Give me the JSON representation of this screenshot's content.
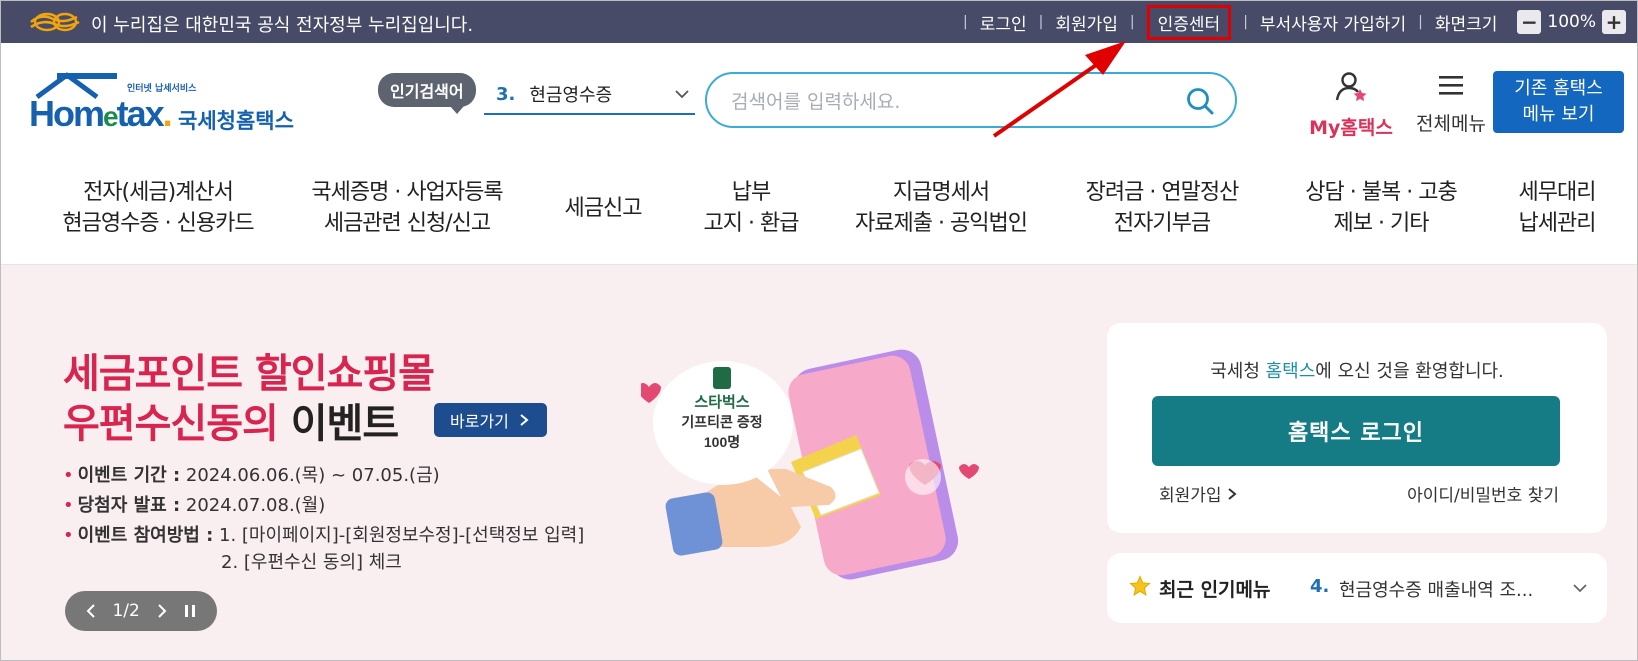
{
  "govbar": {
    "text": "이 누리집은 대한민국 공식 전자정부 누리집입니다.",
    "links": [
      "로그인",
      "회원가입",
      "인증센터",
      "부서사용자 가입하기",
      "화면크기"
    ],
    "zoom_minus": "−",
    "zoom_value": "100%",
    "zoom_plus": "+"
  },
  "header": {
    "logo_sub": "인터넷 납세서비스",
    "logo_brand_a": "Hom",
    "logo_brand_e": "e",
    "logo_brand_b": "tax",
    "logo_brand_dot": ".",
    "logo_kr": "국세청홈택스",
    "popular_badge": "인기검색어",
    "popular_num": "3.",
    "popular_value": "현금영수증",
    "search_placeholder": "검색어를 입력하세요.",
    "my_label": "My홈택스",
    "allmenu_label": "전체메뉴",
    "old_btn_line1": "기존 홈택스",
    "old_btn_line2": "메뉴 보기"
  },
  "nav": [
    {
      "l1": "전자(세금)계산서",
      "l2": "현금영수증 · 신용카드"
    },
    {
      "l1": "국세증명 · 사업자등록",
      "l2": "세금관련 신청/신고"
    },
    {
      "l1": "세금신고",
      "l2": ""
    },
    {
      "l1": "납부",
      "l2": "고지 · 환급"
    },
    {
      "l1": "지급명세서",
      "l2": "자료제출 · 공익법인"
    },
    {
      "l1": "장려금 · 연말정산",
      "l2": "전자기부금"
    },
    {
      "l1": "상담 · 불복 · 고충",
      "l2": "제보 · 기타"
    },
    {
      "l1": "세무대리",
      "l2": "납세관리"
    }
  ],
  "hero": {
    "title1": "세금포인트 할인쇼핑몰",
    "title2_red": "우편수신동의 ",
    "title2_black": "이벤트",
    "go_btn": "바로가기",
    "period_label": "이벤트 기간 :",
    "period_value": " 2024.06.06.(목) ~ 07.05.(금)",
    "announce_label": "당첨자 발표 :",
    "announce_value": " 2024.07.08.(월)",
    "method_label": "이벤트 참여방법 :",
    "method_value1": " 1. [마이페이지]-[회원정보수정]-[선택정보 입력]",
    "method_value2": "2. [우편수신 동의] 체크",
    "pager": "1/2",
    "bubble_l1": "스타벅스",
    "bubble_l2": "기프티콘 증정",
    "bubble_l3": "100명"
  },
  "login": {
    "welcome_a": "국세청 ",
    "welcome_hl": "홈택스",
    "welcome_b": "에 오신 것을 환영합니다.",
    "button": "홈택스 로그인",
    "join": "회원가입",
    "find": "아이디/비밀번호 찾기"
  },
  "recent": {
    "title": "최근 인기메뉴",
    "num": "4.",
    "value": "현금영수증 매출내역 조..."
  },
  "colors": {
    "govbar_bg": "#474b67",
    "hero_bg": "#f9eef0",
    "hero_red": "#d8254f",
    "login_btn": "#157c86",
    "old_menu_btn": "#1367be",
    "highlight_box": "#e00000"
  }
}
